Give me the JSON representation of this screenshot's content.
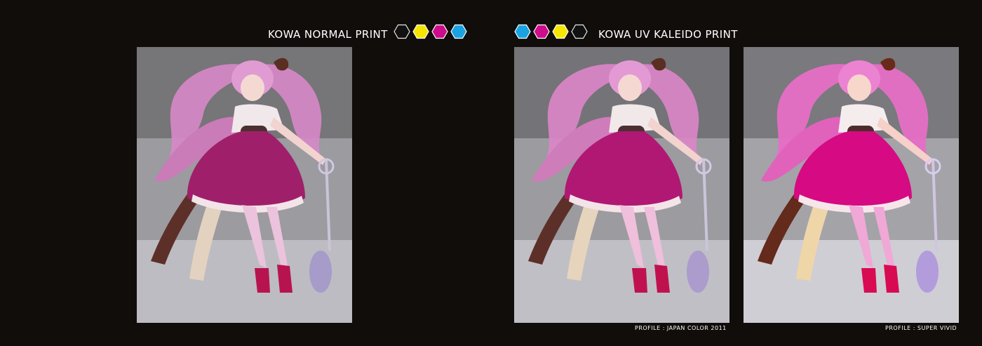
{
  "headings": {
    "normal": "KOWA NORMAL PRINT",
    "kaleido": "KOWA UV KALEIDO PRINT"
  },
  "swatches": {
    "normal": [
      "white",
      "yellow",
      "magenta",
      "cyan"
    ],
    "kaleido": [
      "cyan",
      "magenta",
      "yellow",
      "white"
    ]
  },
  "colors": {
    "background": "#110d0b",
    "cyan": "#1aa3e0",
    "magenta": "#cc0c8a",
    "yellow": "#f6e500",
    "white": "#111111"
  },
  "panels": [
    {
      "variant": "normal",
      "profile": ""
    },
    {
      "variant": "japan-color",
      "profile": "PROFILE : JAPAN COLOR 2011"
    },
    {
      "variant": "super-vivid",
      "profile": "PROFILE : SUPER VIVID"
    }
  ]
}
